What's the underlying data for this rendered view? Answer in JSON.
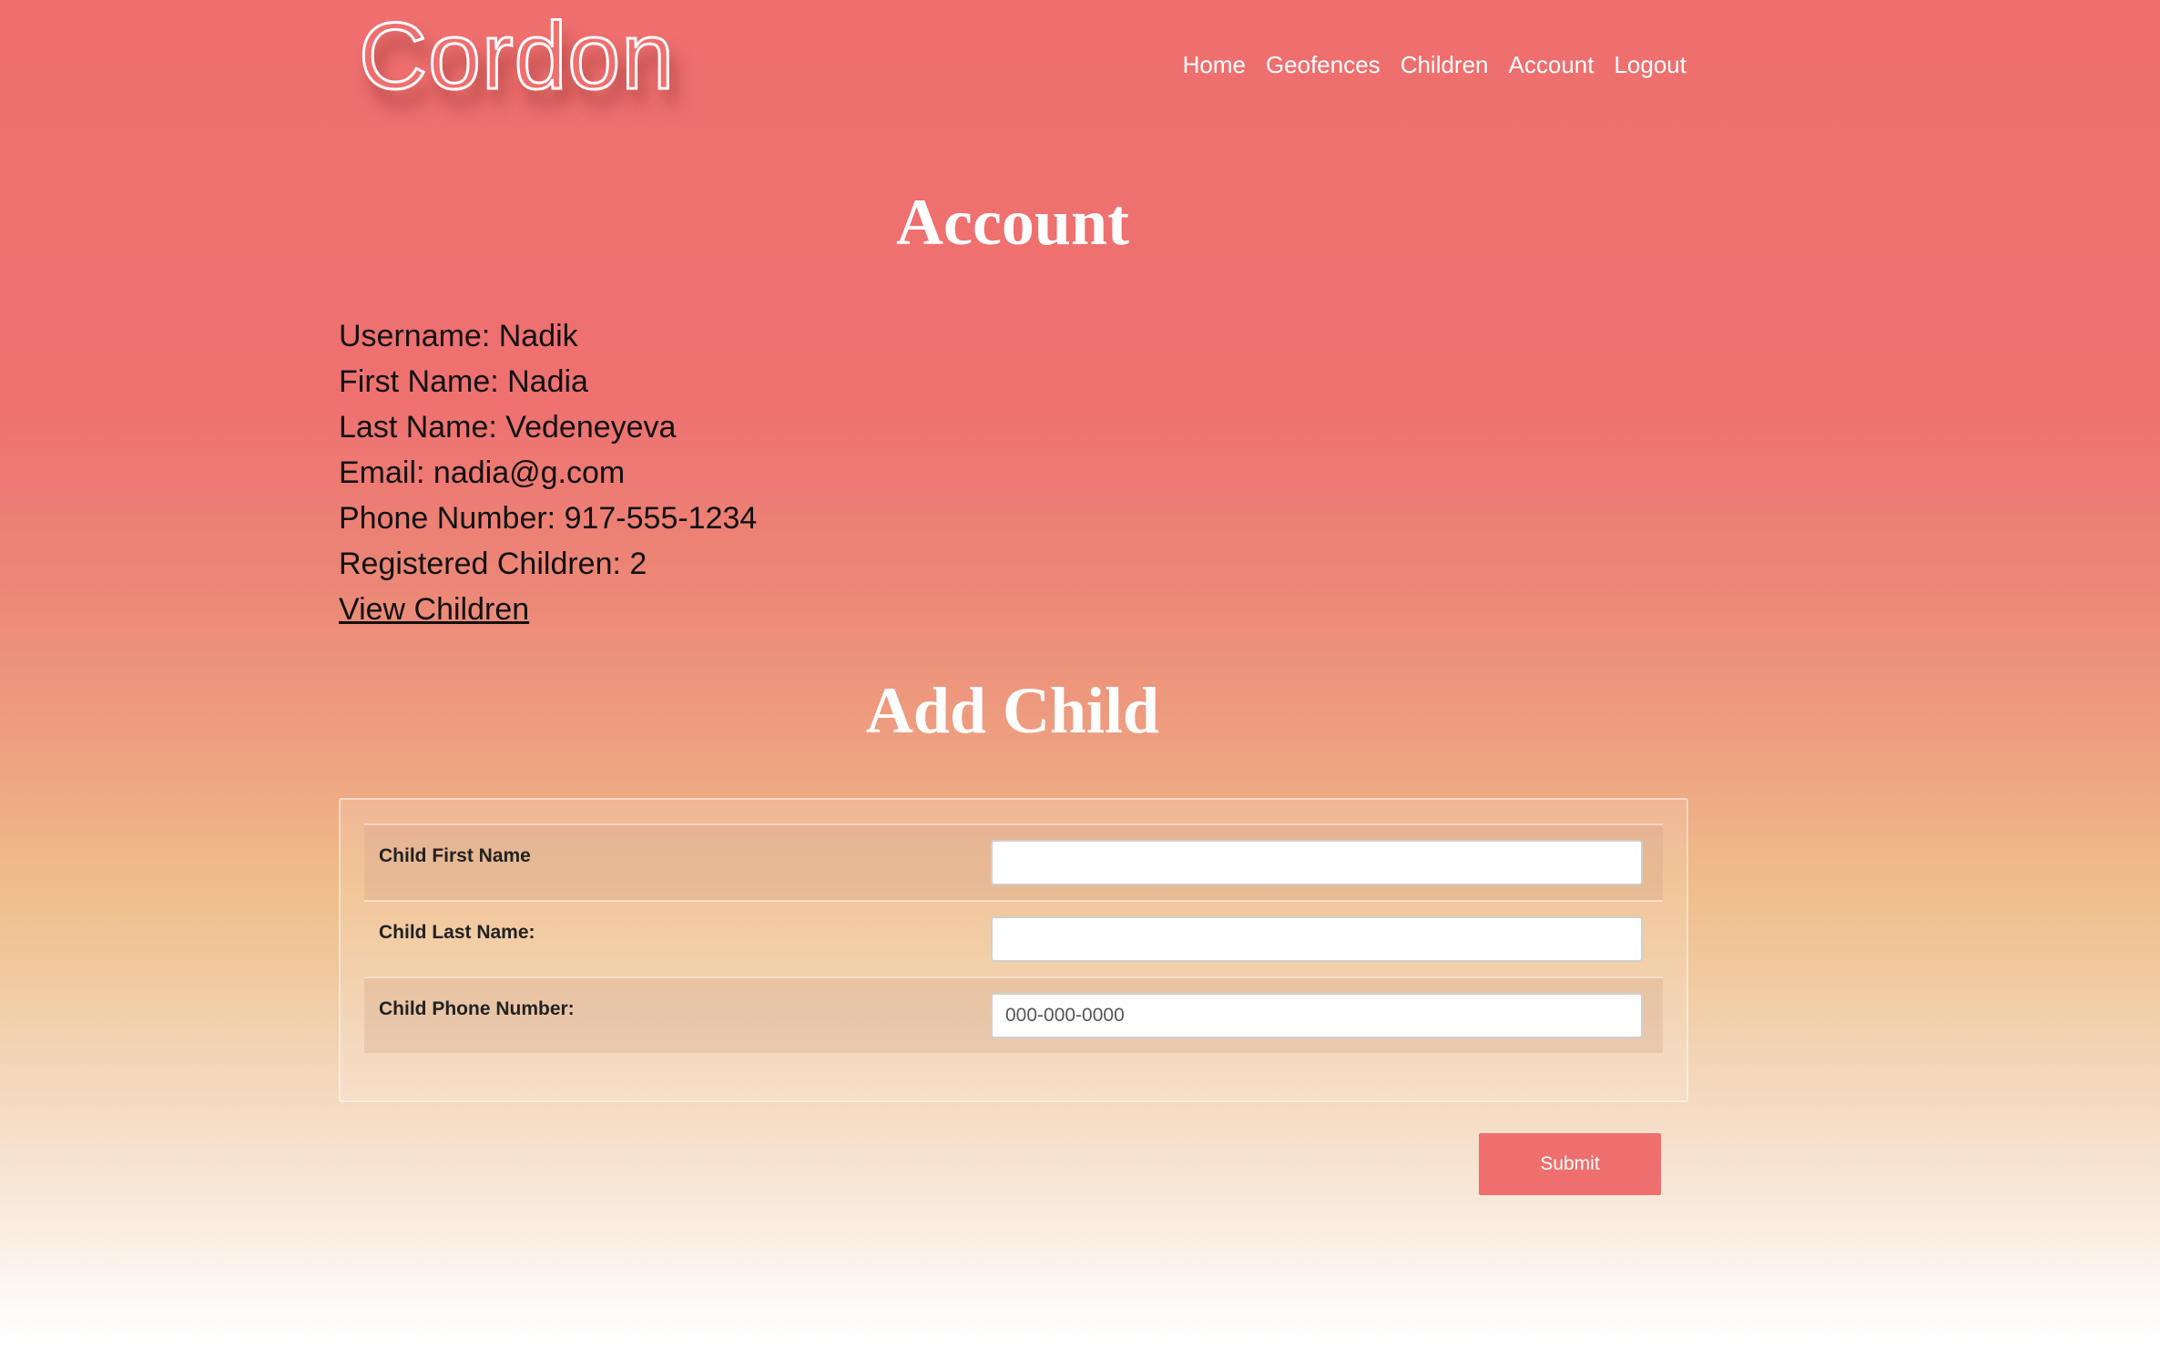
{
  "header": {
    "logo": "Cordon",
    "nav": [
      "Home",
      "Geofences",
      "Children",
      "Account",
      "Logout"
    ]
  },
  "account": {
    "title": "Account",
    "username_line": "Username: Nadik",
    "first_name_line": "First Name: Nadia",
    "last_name_line": "Last Name: Vedeneyeva",
    "email_line": "Email: nadia@g.com",
    "phone_line": "Phone Number: 917-555-1234",
    "children_count_line": "Registered Children: 2",
    "view_children_link": "View Children"
  },
  "add_child": {
    "title": "Add Child",
    "fields": [
      {
        "label": "Child First Name",
        "value": "",
        "placeholder": ""
      },
      {
        "label": "Child Last Name:",
        "value": "",
        "placeholder": ""
      },
      {
        "label": "Child Phone Number:",
        "value": "",
        "placeholder": "000-000-0000"
      }
    ],
    "submit_label": "Submit"
  },
  "colors": {
    "accent": "#ee6f6e",
    "heading_text": "#ffffff"
  }
}
